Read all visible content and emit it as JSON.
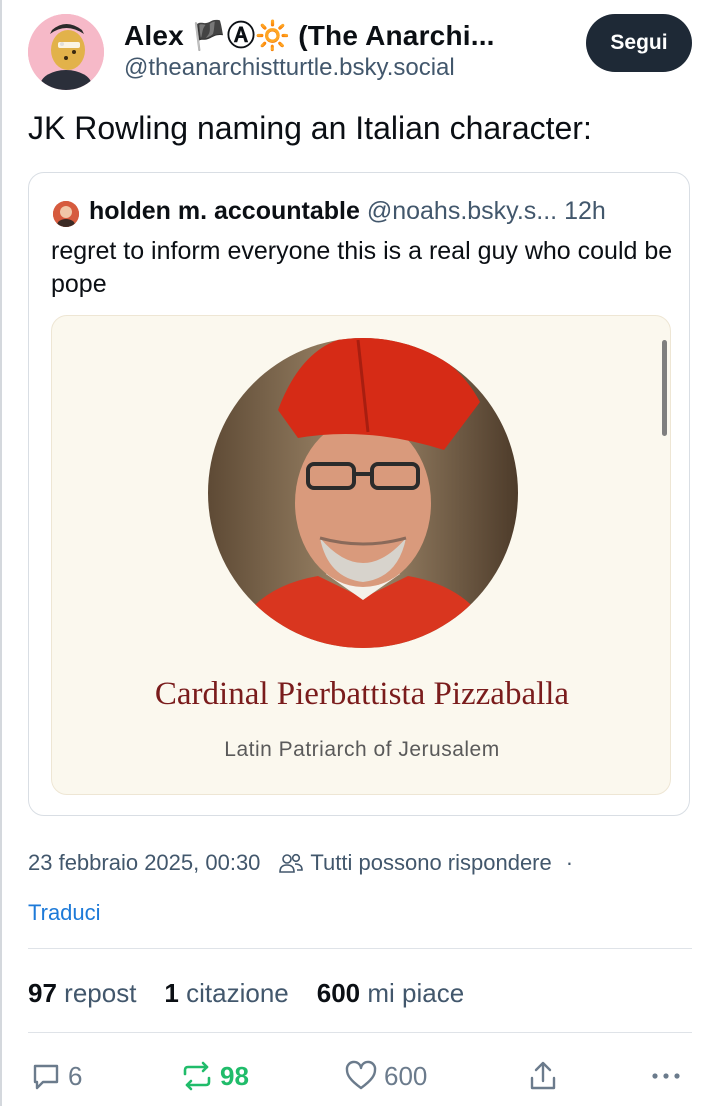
{
  "author": {
    "name": "Alex 🏴Ⓐ🔆 (The Anarchi...",
    "handle": "@theanarchistturtle.bsky.social",
    "follow_label": "Segui"
  },
  "post": {
    "text": "JK Rowling naming an Italian character:"
  },
  "quoted_post": {
    "name": "holden m. accountable",
    "handle": "@noahs.bsky.s...",
    "time": "12h",
    "text": "regret to inform everyone this is a real guy who could be pope",
    "card": {
      "title": "Cardinal Pierbattista Pizzaballa",
      "subtitle": "Latin Patriarch of Jerusalem"
    }
  },
  "meta": {
    "timestamp": "23 febbraio 2025, 00:30",
    "reply_setting": "Tutti possono rispondere",
    "separator": "·",
    "translate_label": "Traduci"
  },
  "stats": {
    "reposts_count": "97",
    "reposts_label": "repost",
    "quotes_count": "1",
    "quotes_label": "citazione",
    "likes_count": "600",
    "likes_label": "mi piace"
  },
  "actions": {
    "reply_count": "6",
    "repost_count": "98",
    "like_count": "600"
  },
  "colors": {
    "accent_blue": "#1d7ad8",
    "repost_green": "#20bc6a",
    "card_title_red": "#7a1c1c",
    "follow_button_bg": "#1e2936"
  }
}
